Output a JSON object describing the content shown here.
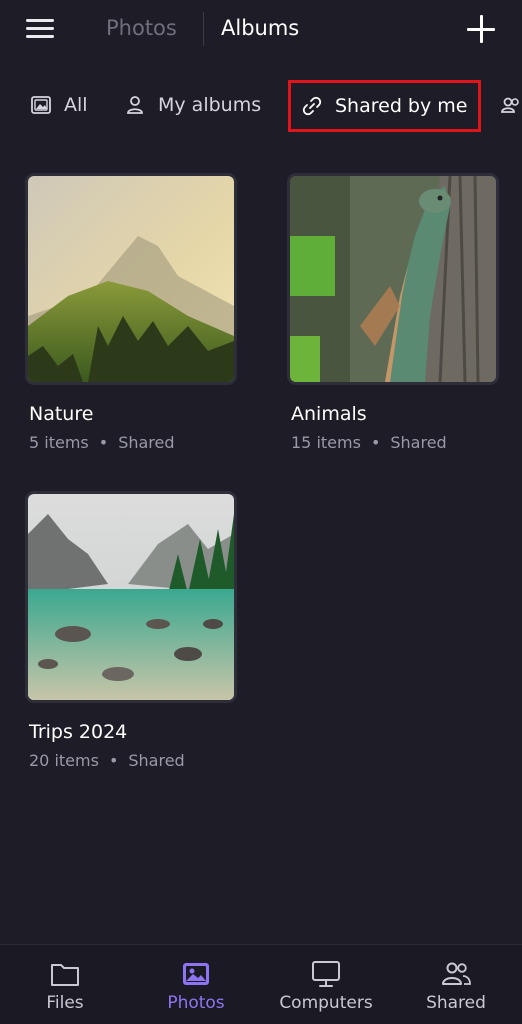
{
  "header": {
    "tab_photos": "Photos",
    "tab_albums": "Albums",
    "menu_icon": "hamburger-menu-icon",
    "add_icon": "plus-icon"
  },
  "filters": [
    {
      "label": "All",
      "icon": "image-icon",
      "active": false
    },
    {
      "label": "My albums",
      "icon": "person-icon",
      "active": false
    },
    {
      "label": "Shared by me",
      "icon": "link-icon",
      "active": true,
      "highlighted": true
    },
    {
      "label": "",
      "icon": "people-icon",
      "active": false
    }
  ],
  "albums": [
    {
      "name": "Nature",
      "count": "5 items",
      "status": "Shared",
      "thumbnail": "misty mountain landscape"
    },
    {
      "name": "Animals",
      "count": "15 items",
      "status": "Shared",
      "thumbnail": "iguana on tree"
    },
    {
      "name": "Trips 2024",
      "count": "20 items",
      "status": "Shared",
      "thumbnail": "mountain lake with rocks"
    }
  ],
  "bottom_nav": [
    {
      "label": "Files",
      "icon": "folder-icon",
      "active": false
    },
    {
      "label": "Photos",
      "icon": "photo-icon",
      "active": true
    },
    {
      "label": "Computers",
      "icon": "monitor-icon",
      "active": false
    },
    {
      "label": "Shared",
      "icon": "people-icon",
      "active": false
    }
  ],
  "colors": {
    "background": "#1d1c27",
    "accent": "#8e74f3",
    "highlight_border": "#e0141b",
    "muted_text": "#9a99a7"
  }
}
